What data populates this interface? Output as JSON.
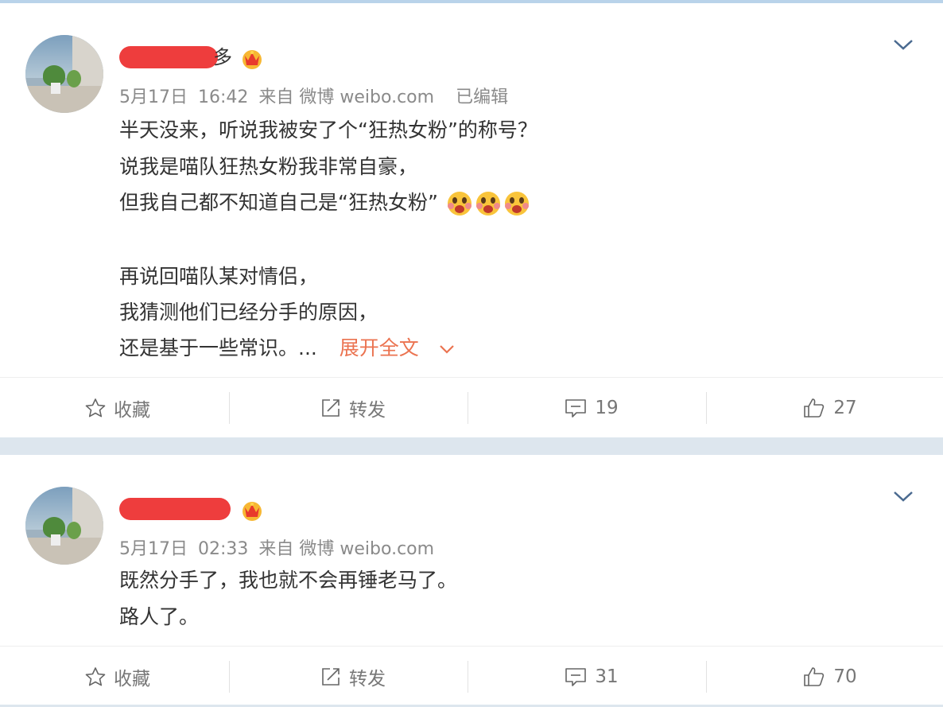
{
  "posts": [
    {
      "name_visible_char": "多",
      "meta": {
        "date": "5月17日",
        "time": "16:42",
        "source": "来自 微博 weibo.com",
        "edited": "已编辑"
      },
      "lines": [
        "半天没来，听说我被安了个“狂热女粉”的称号？",
        "说我是喵队狂热女粉我非常自豪，",
        "但我自己都不知道自己是“狂热女粉”",
        "再说回喵队某对情侣，",
        "我猜测他们已经分手的原因，",
        "还是基于一些常识。..."
      ],
      "expand_label": "展开全文",
      "actions": {
        "favorite": "收藏",
        "repost": "转发",
        "comments": "19",
        "likes": "27"
      }
    },
    {
      "meta": {
        "date": "5月17日",
        "time": "02:33",
        "source": "来自 微博 weibo.com"
      },
      "lines": [
        "既然分手了，我也就不会再锤老马了。",
        "路人了。"
      ],
      "actions": {
        "favorite": "收藏",
        "repost": "转发",
        "comments": "31",
        "likes": "70"
      }
    }
  ],
  "colors": {
    "expand": "#eb7350",
    "meta": "#8a8a8a",
    "redact": "#ee3d3d",
    "background": "#dde6ee"
  },
  "icons": [
    "avatar-image",
    "crown-badge-icon",
    "chevron-down-icon",
    "star-icon",
    "share-icon",
    "comment-icon",
    "thumbs-up-icon",
    "crying-emoji-icon"
  ]
}
